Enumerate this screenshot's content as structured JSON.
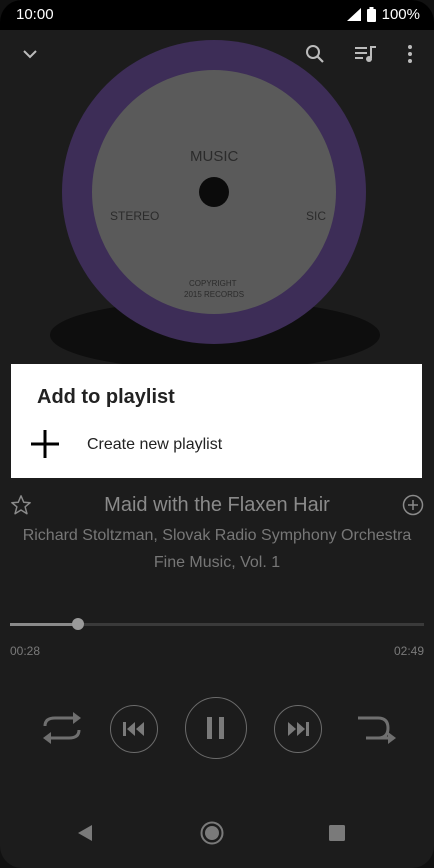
{
  "status": {
    "time": "10:00",
    "battery": "100%"
  },
  "toolbar": {
    "collapse_icon": "chevron-down-icon",
    "search_icon": "search-icon",
    "queue_icon": "queue-music-icon",
    "more_icon": "more-vert-icon"
  },
  "album_art": {
    "label_top": "MUSIC",
    "label_left": "STEREO",
    "label_right": "SIC",
    "copyright_line1": "COPYRIGHT",
    "copyright_line2": "2015 RECORDS",
    "ring_color": "#3d2d57"
  },
  "dialog": {
    "title": "Add to playlist",
    "create_label": "Create new playlist"
  },
  "track": {
    "title": "Maid with the Flaxen Hair",
    "artist": "Richard Stoltzman, Slovak Radio Symphony Orchestra",
    "album": "Fine Music, Vol. 1"
  },
  "progress": {
    "elapsed": "00:28",
    "total": "02:49",
    "fraction": 0.165
  },
  "controls": {
    "repeat": "repeat-icon",
    "previous": "skip-previous-icon",
    "play_pause": "pause-icon",
    "next": "skip-next-icon",
    "shuffle": "shuffle-icon"
  },
  "nav": {
    "back": "back-icon",
    "home": "home-icon",
    "recents": "recents-icon"
  }
}
